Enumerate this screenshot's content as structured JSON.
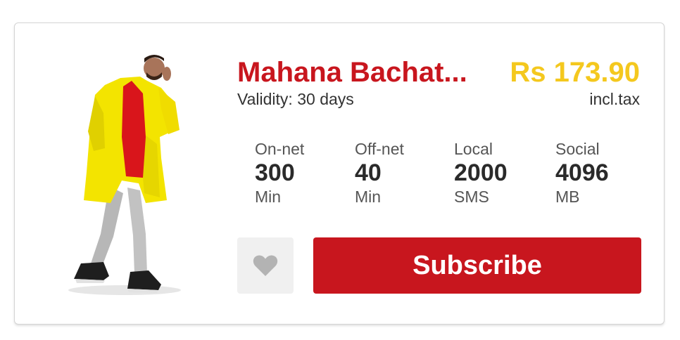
{
  "bundle": {
    "title": "Mahana Bachat...",
    "validity": "Validity: 30 days",
    "price": "Rs 173.90",
    "tax_note": "incl.tax"
  },
  "stats": [
    {
      "label": "On-net",
      "value": "300",
      "unit": "Min"
    },
    {
      "label": "Off-net",
      "value": "40",
      "unit": "Min"
    },
    {
      "label": "Local",
      "value": "2000",
      "unit": "SMS"
    },
    {
      "label": "Social",
      "value": "4096",
      "unit": "MB"
    }
  ],
  "actions": {
    "favorite_icon": "heart-icon",
    "subscribe_label": "Subscribe"
  },
  "colors": {
    "title": "#c8161e",
    "price": "#f4c81e",
    "subscribe_bg": "#c8161e",
    "favorite_bg": "#f0f0f0",
    "heart": "#b3b3b3"
  }
}
